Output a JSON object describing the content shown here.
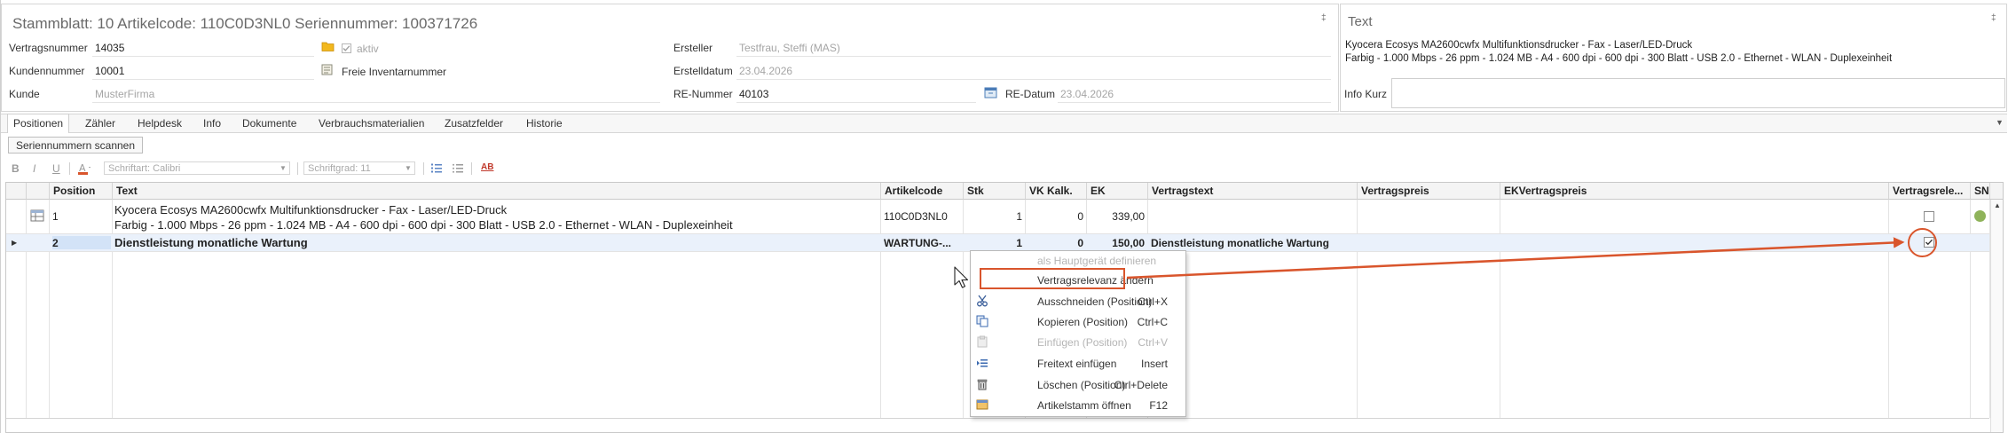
{
  "header": {
    "title": "Stammblatt: 10 Artikelcode: 110C0D3NL0 Seriennummer: 100371726",
    "fields": {
      "vertragsnummer_label": "Vertragsnummer",
      "vertragsnummer_value": "14035",
      "aktiv_label": "aktiv",
      "kundennummer_label": "Kundennummer",
      "kundennummer_value": "10001",
      "freie_inventarnummer_label": "Freie Inventarnummer",
      "kunde_label": "Kunde",
      "kunde_value": "MusterFirma",
      "ersteller_label": "Ersteller",
      "ersteller_value": "Testfrau, Steffi (MAS)",
      "erstelldatum_label": "Erstelldatum",
      "erstelldatum_value": "23.04.2026",
      "re_nummer_label": "RE-Nummer",
      "re_nummer_value": "40103",
      "re_datum_label": "RE-Datum",
      "re_datum_value": "23.04.2026"
    }
  },
  "text_panel": {
    "title": "Text",
    "line1": "Kyocera Ecosys MA2600cwfx Multifunktionsdrucker - Fax - Laser/LED-Druck",
    "line2": "Farbig - 1.000 Mbps - 26 ppm - 1.024 MB - A4 - 600 dpi - 600 dpi - 300 Blatt - USB 2.0 - Ethernet - WLAN - Duplexeinheit",
    "info_kurz_label": "Info Kurz"
  },
  "tabs": [
    {
      "label": "Positionen"
    },
    {
      "label": "Zähler"
    },
    {
      "label": "Helpdesk"
    },
    {
      "label": "Info"
    },
    {
      "label": "Dokumente"
    },
    {
      "label": "Verbrauchsmaterialien"
    },
    {
      "label": "Zusatzfelder"
    },
    {
      "label": "Historie"
    }
  ],
  "toolbar": {
    "scan_label": "Seriennummern scannen",
    "bold": "B",
    "italic": "I",
    "underline": "U",
    "font_combo": "Schriftart: Calibri",
    "size_combo": "Schriftgrad: 11",
    "ab": "AB"
  },
  "grid": {
    "columns": [
      "Position",
      "Text",
      "Artikelcode",
      "Stk",
      "VK Kalk.",
      "EK",
      "Vertragstext",
      "Vertragspreis",
      "EKVertragspreis",
      "Vertragsrele...",
      "SN"
    ],
    "rows": [
      {
        "position": "1",
        "text_line1": "Kyocera Ecosys MA2600cwfx Multifunktionsdrucker - Fax - Laser/LED-Druck",
        "text_line2": "Farbig - 1.000 Mbps - 26 ppm - 1.024 MB - A4 - 600 dpi - 600 dpi - 300 Blatt - USB 2.0 - Ethernet - WLAN - Duplexeinheit",
        "artikelcode": "110C0D3NL0",
        "stk": "1",
        "vk_kalk": "0",
        "ek": "339,00",
        "vertragstext": "",
        "checked": false
      },
      {
        "position": "2",
        "text_line1": "Dienstleistung monatliche Wartung",
        "artikelcode": "WARTUNG-...",
        "stk": "1",
        "vk_kalk": "0",
        "ek": "150,00",
        "vertragstext": "Dienstleistung monatliche Wartung",
        "checked": true
      }
    ]
  },
  "context_menu": {
    "items": [
      {
        "label": "als Hauptgerät definieren",
        "shortcut": "",
        "disabled": true
      },
      {
        "label": "Vertragsrelevanz ändern",
        "shortcut": "",
        "disabled": false
      },
      {
        "label": "Ausschneiden (Position)",
        "shortcut": "Ctrl+X",
        "disabled": false
      },
      {
        "label": "Kopieren (Position)",
        "shortcut": "Ctrl+C",
        "disabled": false
      },
      {
        "label": "Einfügen (Position)",
        "shortcut": "Ctrl+V",
        "disabled": true
      },
      {
        "label": "Freitext einfügen",
        "shortcut": "Insert",
        "disabled": false
      },
      {
        "label": "Löschen (Position)",
        "shortcut": "Ctrl+Delete",
        "disabled": false
      },
      {
        "label": "Artikelstamm öffnen",
        "shortcut": "F12",
        "disabled": false
      }
    ]
  },
  "colors": {
    "annotation": "#d9552c",
    "sn_dot": "#8fb35a",
    "selected_row": "#eaf1fb"
  }
}
